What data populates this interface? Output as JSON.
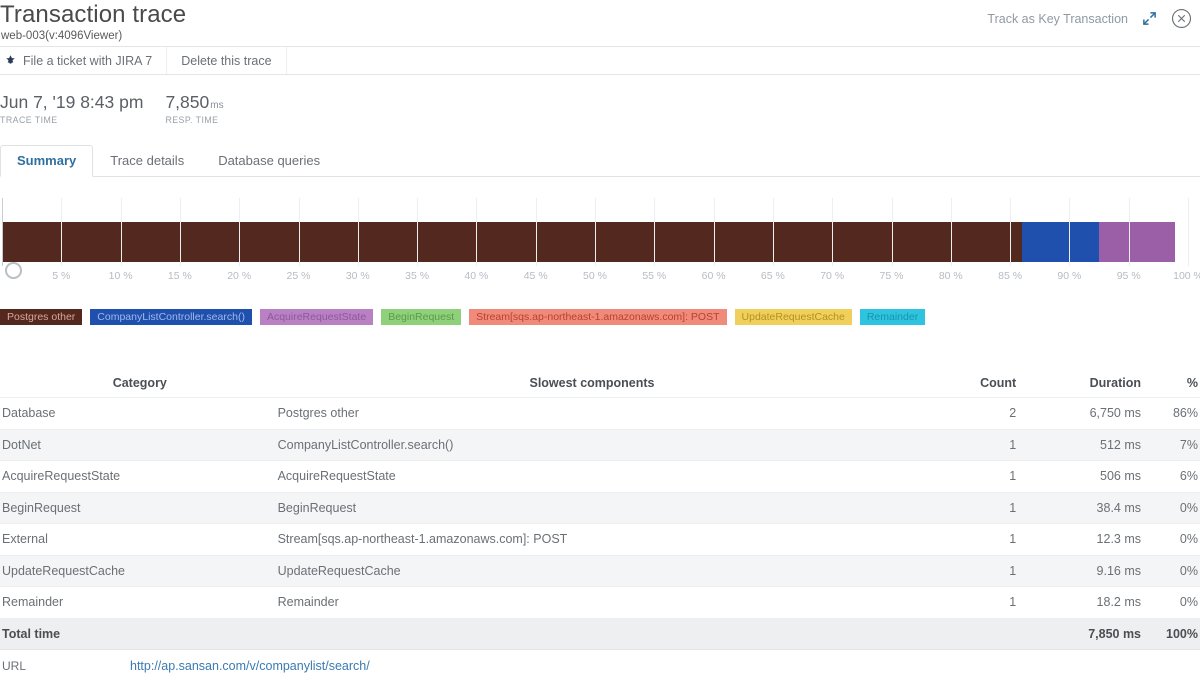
{
  "header": {
    "title": "Transaction trace",
    "subtitle": "web-003(v:4096Viewer)",
    "track_label": "Track as Key Transaction",
    "expand_icon": "expand-icon",
    "close_icon": "close-icon"
  },
  "toolbar": {
    "jira_icon": "jira-icon",
    "jira_label": "File a ticket with JIRA 7",
    "delete_label": "Delete this trace"
  },
  "stats": [
    {
      "value": "Jun 7, '19 8:43 pm",
      "unit": "",
      "label": "TRACE TIME"
    },
    {
      "value": "7,850",
      "unit": "ms",
      "label": "RESP. TIME"
    }
  ],
  "tabs": [
    {
      "label": "Summary",
      "active": true
    },
    {
      "label": "Trace details",
      "active": false
    },
    {
      "label": "Database queries",
      "active": false
    }
  ],
  "chart_data": {
    "type": "bar",
    "title": "",
    "xlabel": "",
    "ylabel": "",
    "xlim": [
      0,
      100
    ],
    "grid": true,
    "legend_position": "bottom",
    "orientation": "horizontal-stacked",
    "tick_labels": [
      "5 %",
      "10 %",
      "15 %",
      "20 %",
      "25 %",
      "30 %",
      "35 %",
      "40 %",
      "45 %",
      "50 %",
      "55 %",
      "60 %",
      "65 %",
      "70 %",
      "75 %",
      "80 %",
      "85 %",
      "90 %",
      "95 %",
      "100 %"
    ],
    "tick_values": [
      5,
      10,
      15,
      20,
      25,
      30,
      35,
      40,
      45,
      50,
      55,
      60,
      65,
      70,
      75,
      80,
      85,
      90,
      95,
      100
    ],
    "categories": [
      "Postgres other",
      "CompanyListController.search()",
      "AcquireRequestState",
      "BeginRequest",
      "Stream[sqs.ap-northeast-1.amazonaws.com]: POST",
      "UpdateRequestCache",
      "Remainder"
    ],
    "values": [
      86,
      7,
      6,
      0,
      0,
      0,
      0
    ],
    "segments": [
      {
        "name": "Postgres other",
        "percent": 86,
        "color": "#53291f"
      },
      {
        "name": "CompanyListController.search()",
        "percent": 6.5,
        "color": "#2050ad"
      },
      {
        "name": "AcquireRequestState",
        "percent": 6.4,
        "color": "#9a5fa6"
      }
    ],
    "legend": [
      {
        "label": "Postgres other",
        "bg": "#53291f",
        "fg": "#d9a79a"
      },
      {
        "label": "CompanyListController.search()",
        "bg": "#2050ad",
        "fg": "#9fb8e8"
      },
      {
        "label": "AcquireRequestState",
        "bg": "#b980c4",
        "fg": "#8b5b96"
      },
      {
        "label": "BeginRequest",
        "bg": "#8fd07a",
        "fg": "#5d9a4c"
      },
      {
        "label": "Stream[sqs.ap-northeast-1.amazonaws.com]: POST",
        "bg": "#f08a7a",
        "fg": "#b8412f"
      },
      {
        "label": "UpdateRequestCache",
        "bg": "#f0d05a",
        "fg": "#b09226"
      },
      {
        "label": "Remainder",
        "bg": "#2ec4e0",
        "fg": "#1b93ab"
      }
    ]
  },
  "table": {
    "columns": [
      "Category",
      "Slowest components",
      "Count",
      "Duration",
      "%"
    ],
    "rows": [
      {
        "category": "Database",
        "component": "Postgres other",
        "count": "2",
        "duration": "6,750 ms",
        "pct": "86%"
      },
      {
        "category": "DotNet",
        "component": "CompanyListController.search()",
        "count": "1",
        "duration": "512 ms",
        "pct": "7%"
      },
      {
        "category": "AcquireRequestState",
        "component": "AcquireRequestState",
        "count": "1",
        "duration": "506 ms",
        "pct": "6%"
      },
      {
        "category": "BeginRequest",
        "component": "BeginRequest",
        "count": "1",
        "duration": "38.4 ms",
        "pct": "0%"
      },
      {
        "category": "External",
        "component": "Stream[sqs.ap-northeast-1.amazonaws.com]: POST",
        "count": "1",
        "duration": "12.3 ms",
        "pct": "0%"
      },
      {
        "category": "UpdateRequestCache",
        "component": "UpdateRequestCache",
        "count": "1",
        "duration": "9.16 ms",
        "pct": "0%"
      },
      {
        "category": "Remainder",
        "component": "Remainder",
        "count": "1",
        "duration": "18.2 ms",
        "pct": "0%"
      }
    ],
    "total": {
      "category": "Total time",
      "component": "",
      "count": "",
      "duration": "7,850 ms",
      "pct": "100%"
    }
  },
  "url": {
    "label": "URL",
    "value": "http://ap.sansan.com/v/companylist/search/"
  }
}
